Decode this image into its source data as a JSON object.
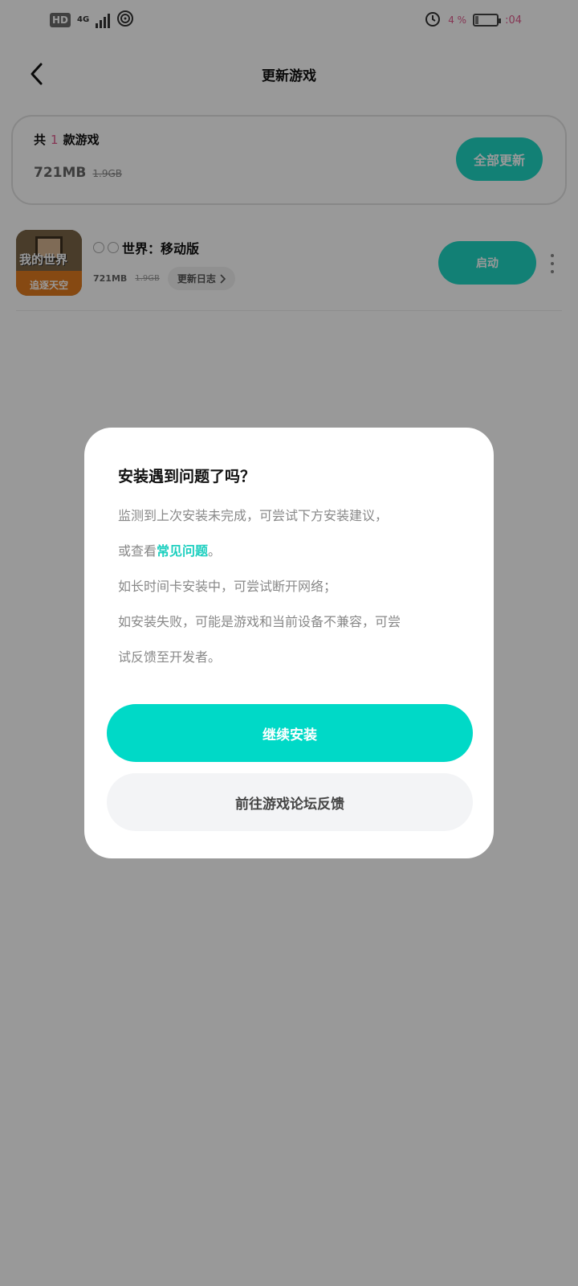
{
  "status_bar": {
    "hd": "HD",
    "network": "4G",
    "battery_percent": "4 %",
    "battery_level": 0.15,
    "time": ":04"
  },
  "nav": {
    "title": "更新游戏"
  },
  "summary": {
    "count_prefix": "共",
    "count": "1",
    "count_suffix": "款游戏",
    "size_new": "721MB",
    "size_old": "1.9GB",
    "update_all_label": "全部更新"
  },
  "game": {
    "icon_title": "我的世界",
    "icon_subtitle": "追逐天空",
    "name": "世界：移动版",
    "size_new": "721MB",
    "size_old": "1.9GB",
    "changelog_label": "更新日志",
    "launch_label": "启动"
  },
  "dialog": {
    "title": "安装遇到问题了吗？",
    "line1": "监测到上次安装未完成，可尝试下方安装建议，",
    "line2_prefix": "或查看",
    "faq_link": "常见问题",
    "line2_suffix": "。",
    "line3": "如长时间卡安装中，可尝试断开网络；",
    "line4": "如安装失败，可能是游戏和当前设备不兼容，可尝",
    "line5": "试反馈至开发者。",
    "continue_label": "继续安装",
    "forum_label": "前往游戏论坛反馈"
  }
}
